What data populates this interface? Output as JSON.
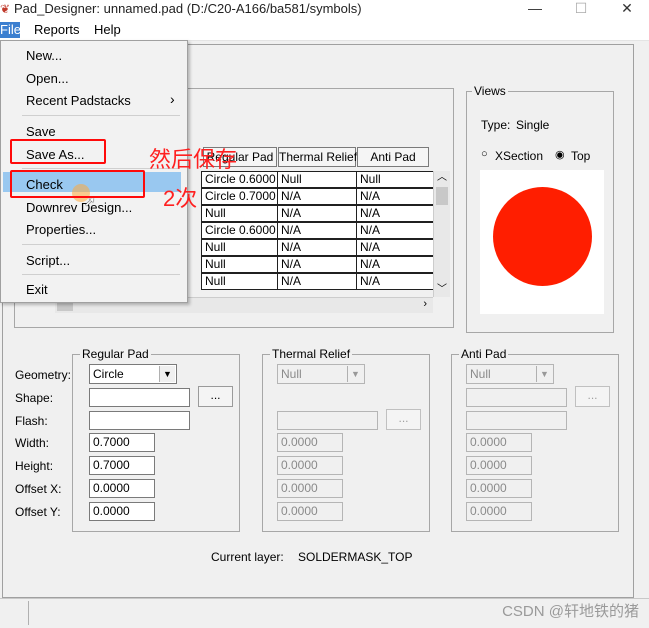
{
  "window": {
    "title": "Pad_Designer: unnamed.pad (D:/C20-A166/ba581/symbols)",
    "minimize": "—",
    "maximize": "☐",
    "close": "✕"
  },
  "menubar": {
    "file": "File",
    "reports": "Reports",
    "help": "Help"
  },
  "file_menu": {
    "new": "New...",
    "open": "Open...",
    "recent": "Recent Padstacks",
    "recent_arrow": "›",
    "save": "Save",
    "save_as": "Save As...",
    "check": "Check",
    "downrev": "Downrev Design...",
    "properties": "Properties...",
    "script": "Script...",
    "exit": "Exit"
  },
  "annotations": {
    "then_save": "然后保存",
    "twice": "2次"
  },
  "views": {
    "title": "Views",
    "type_label": "Type:",
    "type_value": "Single",
    "xsection": "XSection",
    "top": "Top",
    "pad_color": "#ff1e00"
  },
  "layers_table": {
    "headers": [
      "Regular Pad",
      "Thermal Relief",
      "Anti Pad"
    ],
    "rows": [
      [
        "Circle 0.6000",
        "Null",
        "Null"
      ],
      [
        "Circle 0.7000",
        "N/A",
        "N/A"
      ],
      [
        "Null",
        "N/A",
        "N/A"
      ],
      [
        "Circle 0.6000",
        "N/A",
        "N/A"
      ],
      [
        "Null",
        "N/A",
        "N/A"
      ],
      [
        "Null",
        "N/A",
        "N/A"
      ],
      [
        "Null",
        "N/A",
        "N/A"
      ]
    ]
  },
  "regular_pad": {
    "title": "Regular Pad",
    "geometry": "Circle",
    "shape": "",
    "flash": "",
    "width": "0.7000",
    "height": "0.7000",
    "offset_x": "0.0000",
    "offset_y": "0.0000",
    "browse": "..."
  },
  "thermal_relief": {
    "title": "Thermal Relief",
    "geometry": "Null",
    "flash": "",
    "width": "0.0000",
    "height": "0.0000",
    "offset_x": "0.0000",
    "offset_y": "0.0000",
    "browse": "..."
  },
  "anti_pad": {
    "title": "Anti Pad",
    "geometry": "Null",
    "shape": "",
    "width": "0.0000",
    "height": "0.0000",
    "offset_x": "0.0000",
    "offset_y": "0.0000",
    "browse": "..."
  },
  "form_labels": {
    "geometry": "Geometry:",
    "shape": "Shape:",
    "flash": "Flash:",
    "width": "Width:",
    "height": "Height:",
    "offset_x": "Offset X:",
    "offset_y": "Offset Y:"
  },
  "current_layer": {
    "label": "Current layer:",
    "value": "SOLDERMASK_TOP"
  },
  "watermark": "CSDN @轩地铁的猪"
}
